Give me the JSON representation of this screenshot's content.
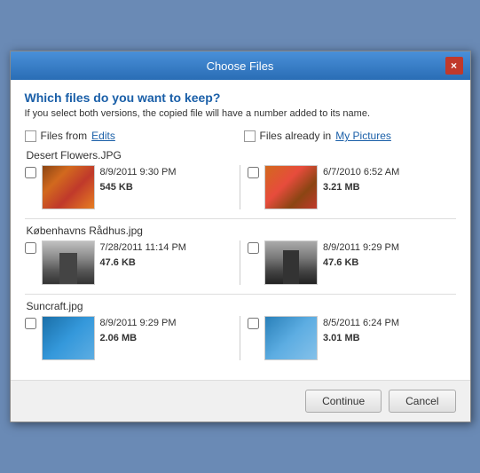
{
  "titleBar": {
    "title": "Choose Files",
    "closeIcon": "×"
  },
  "header": {
    "question": "Which files do you want to keep?",
    "subtitle": "If you select both versions, the copied file will have a number added to its name."
  },
  "columns": {
    "left": {
      "checkboxLabel": "Files from",
      "linkText": "Edits"
    },
    "right": {
      "checkboxLabel": "Files already in",
      "linkText": "My Pictures"
    }
  },
  "files": [
    {
      "name": "Desert Flowers.JPG",
      "left": {
        "datetime": "8/9/2011 9:30 PM",
        "size": "545 KB",
        "thumb": "flowers-left"
      },
      "right": {
        "datetime": "6/7/2010 6:52 AM",
        "size": "3.21 MB",
        "thumb": "flowers-right"
      }
    },
    {
      "name": "Københavns Rådhus.jpg",
      "left": {
        "datetime": "7/28/2011 11:14 PM",
        "size": "47.6 KB",
        "thumb": "tower-left"
      },
      "right": {
        "datetime": "8/9/2011 9:29 PM",
        "size": "47.6 KB",
        "thumb": "tower-right"
      }
    },
    {
      "name": "Suncraft.jpg",
      "left": {
        "datetime": "8/9/2011 9:29 PM",
        "size": "2.06 MB",
        "thumb": "sun-left"
      },
      "right": {
        "datetime": "8/5/2011 6:24 PM",
        "size": "3.01 MB",
        "thumb": "sun-right"
      }
    }
  ],
  "buttons": {
    "continue": "Continue",
    "cancel": "Cancel"
  }
}
